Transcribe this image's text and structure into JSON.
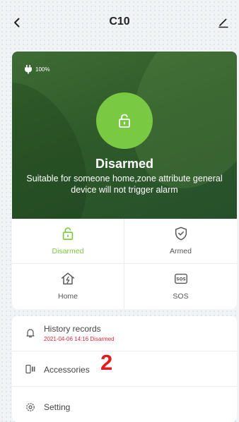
{
  "header": {
    "title": "C10"
  },
  "status": {
    "battery": "100%",
    "state": "Disarmed",
    "description": "Suitable for someone home,zone attribute general device will not trigger alarm"
  },
  "modes": [
    {
      "label": "Disarmed",
      "icon": "unlock-icon",
      "active": true
    },
    {
      "label": "Armed",
      "icon": "shield-check-icon",
      "active": false
    },
    {
      "label": "Home",
      "icon": "home-icon",
      "active": false
    },
    {
      "label": "SOS",
      "icon": "sos-icon",
      "active": false
    }
  ],
  "list": {
    "history_label": "History records",
    "history_sub": "2021-04-06 14:16 Disarmed",
    "accessories_label": "Accessories",
    "setting_label": "Setting"
  },
  "annotation": "2",
  "colors": {
    "accent": "#7ac943",
    "panel": "#2f5a2a",
    "alert_text": "#e0263a",
    "annotation": "#e41b1b"
  }
}
